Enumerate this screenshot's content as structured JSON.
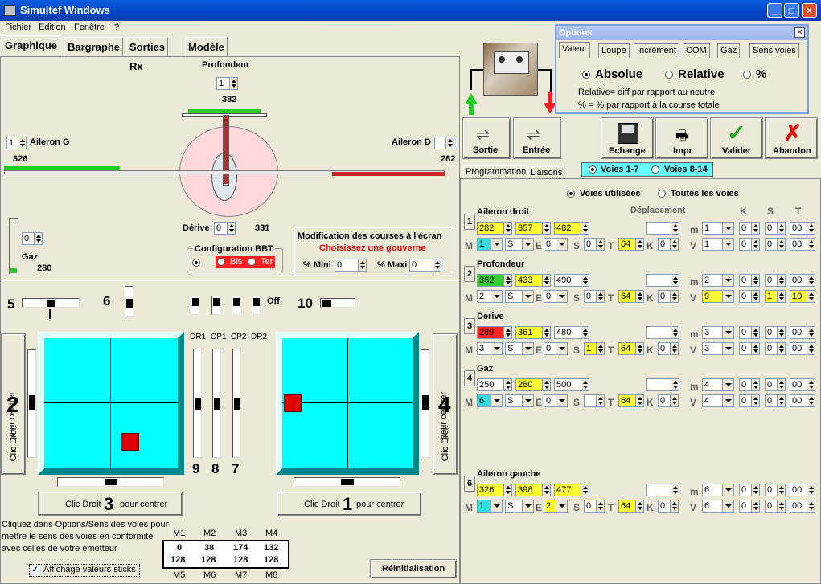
{
  "window": {
    "title": "Simultef Windows"
  },
  "menu": [
    "Fichier",
    "Edition",
    "Fenêtre",
    "?"
  ],
  "tabs": [
    "Graphique",
    "Bargraphe",
    "Sorties Rx",
    "Modèle"
  ],
  "graph": {
    "profondeur_label": "Profondeur",
    "profondeur_spin": "1",
    "profondeur_value": "382",
    "ailerong_label": "Aileron G",
    "ailerong_spin": "1",
    "ailerong_value": "326",
    "ailerond_label": "Aileron D",
    "ailerond_value": "282",
    "derive_label": "Dérive",
    "derive_spin": "0",
    "derive_value": "331",
    "gaz_label": "Gaz",
    "gaz_spin": "0",
    "gaz_value": "280",
    "bbt_label": "Configuration BBT",
    "bbt_bis": "Bis",
    "bbt_ter": "Ter",
    "mod_title": "Modification des courses à l'écran",
    "mod_sub": "Choisissez une gouverne",
    "mini_label": "% Mini",
    "mini_val": "0",
    "maxi_label": "% Maxi",
    "maxi_val": "0"
  },
  "sticks": {
    "s5": "5",
    "s6": "6",
    "s10": "10",
    "off": "Off",
    "dr1": "DR1",
    "cp1": "CP1",
    "cp2": "CP2",
    "dr2": "DR2",
    "n9": "9",
    "n8": "8",
    "n7": "7",
    "left_num": "2",
    "right_num": "4",
    "left_bottom_num": "3",
    "right_bottom_num": "1",
    "clic_droit": "Clic Droit",
    "pour_centrer": "pour centrer",
    "help": "Cliquez dans Options/Sens des voies pour mettre le sens des voies en conformité avec celles de votre émetteur",
    "checkbox": "Affichage valeurs sticks",
    "reinit": "Réinitialisation",
    "m_top": [
      "M1",
      "M2",
      "M3",
      "M4"
    ],
    "m_bot": [
      "M5",
      "M6",
      "M7",
      "M8"
    ],
    "row1": [
      "0",
      "38",
      "174",
      "132"
    ],
    "row2": [
      "128",
      "128",
      "128",
      "128"
    ]
  },
  "toolbar": {
    "sortie": "Sortie",
    "entree": "Entrée",
    "echange": "Echange",
    "impr": "Impr",
    "valider": "Valider",
    "abandon": "Abandon"
  },
  "voies": {
    "v17": "Voies 1-7",
    "v814": "Voies 8-14"
  },
  "prog": {
    "tab1": "Programmation",
    "tab2": "Liaisons",
    "used": "Voies utilisées",
    "all": "Toutes les voies",
    "deplacement": "Déplacement",
    "K": "K",
    "S": "S",
    "T": "T",
    "m": "m",
    "V": "V",
    "M": "M",
    "E": "E"
  },
  "channels": [
    {
      "num": "1",
      "name": "Aileron droit",
      "v1": "282",
      "v2": "357",
      "v3": "482",
      "c1": "yel",
      "c2": "yel",
      "c3": "yel",
      "M": "1",
      "Mcol": "cyan",
      "S": "S",
      "E": "0",
      "S2": "0",
      "T": "64",
      "K": "0",
      "m": "1",
      "V": "1",
      "k1": "0",
      "k2": "0",
      "k3": "00",
      "k4": "0",
      "k5": "0",
      "k6": "00",
      "vcol": ""
    },
    {
      "num": "2",
      "name": "Profondeur",
      "v1": "362",
      "v2": "433",
      "v3": "490",
      "c1": "grn",
      "c2": "yel",
      "c3": "",
      "M": "2",
      "Mcol": "",
      "S": "S",
      "E": "0",
      "S2": "0",
      "T": "64",
      "K": "0",
      "m": "2",
      "V": "9",
      "k1": "0",
      "k2": "0",
      "k3": "00",
      "k4": "0",
      "k5": "1",
      "k6": "10",
      "vcol": "yel"
    },
    {
      "num": "3",
      "name": "Derive",
      "v1": "289",
      "v2": "361",
      "v3": "480",
      "c1": "red",
      "c2": "yel",
      "c3": "",
      "M": "3",
      "Mcol": "",
      "S": "S",
      "E": "0",
      "S2": "1",
      "T": "64",
      "K": "0",
      "m": "3",
      "V": "3",
      "k1": "0",
      "k2": "0",
      "k3": "00",
      "k4": "0",
      "k5": "0",
      "k6": "00",
      "vcol": ""
    },
    {
      "num": "4",
      "name": "Gaz",
      "v1": "250",
      "v2": "280",
      "v3": "500",
      "c1": "",
      "c2": "yel",
      "c3": "",
      "M": "6",
      "Mcol": "cyan",
      "S": "S",
      "E": "0",
      "S2": "",
      "T": "64",
      "K": "0",
      "m": "4",
      "V": "4",
      "k1": "0",
      "k2": "0",
      "k3": "00",
      "k4": "0",
      "k5": "0",
      "k6": "00",
      "vcol": ""
    },
    {
      "num": "6",
      "name": "Aileron gauche",
      "v1": "326",
      "v2": "398",
      "v3": "477",
      "c1": "yel",
      "c2": "yel",
      "c3": "yel",
      "M": "1",
      "Mcol": "cyan",
      "S": "S",
      "E": "2",
      "S2": "0",
      "T": "64",
      "K": "0",
      "m": "6",
      "V": "6",
      "k1": "0",
      "k2": "0",
      "k3": "00",
      "k4": "0",
      "k5": "0",
      "k6": "00",
      "vcol": ""
    }
  ],
  "options": {
    "title": "Options",
    "tabs": [
      "Valeur",
      "Loupe",
      "Incrément",
      "COM",
      "Gaz",
      "Sens voies"
    ],
    "absolue": "Absolue",
    "relative": "Relative",
    "pct": "%",
    "note1": "Relative= diff par rapport au neutre",
    "note2": "% = % par rapport à la course totale"
  }
}
